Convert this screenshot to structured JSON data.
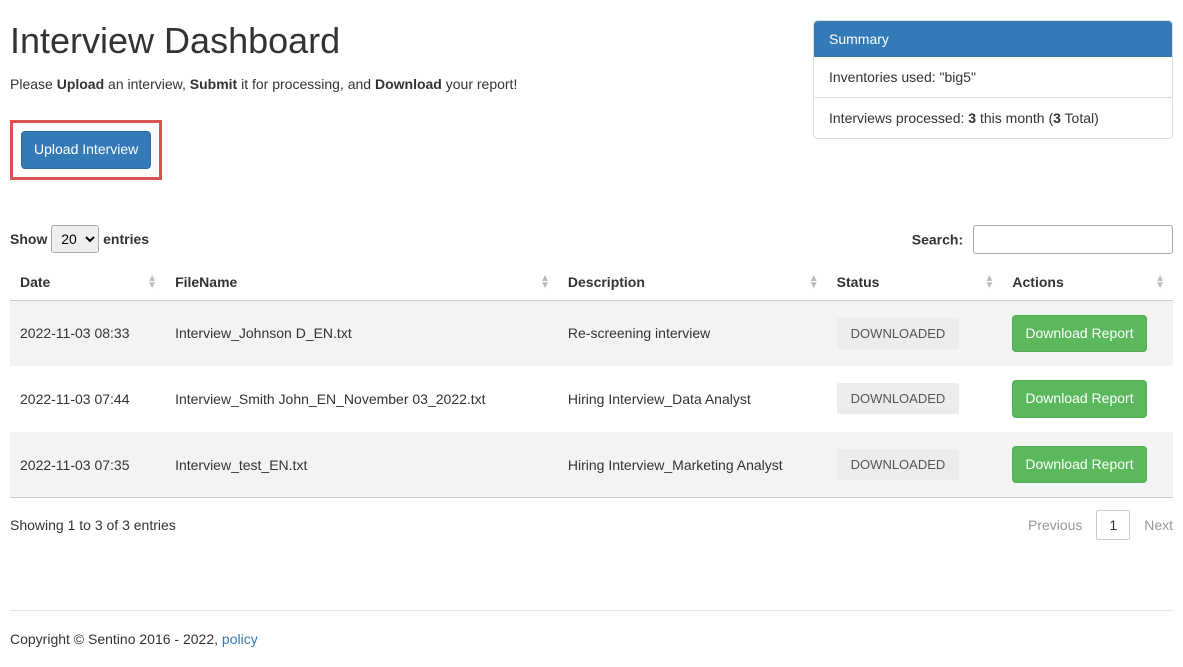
{
  "header": {
    "title": "Interview Dashboard",
    "intro_pre": "Please ",
    "intro_b1": "Upload",
    "intro_mid1": " an interview, ",
    "intro_b2": "Submit",
    "intro_mid2": " it for processing, and ",
    "intro_b3": "Download",
    "intro_post": " your report!",
    "upload_btn": "Upload Interview"
  },
  "summary": {
    "heading": "Summary",
    "line1": "Inventories used: \"big5\"",
    "line2_pre": "Interviews processed: ",
    "line2_this_month": "3",
    "line2_mid": " this month (",
    "line2_total": "3",
    "line2_post": " Total)"
  },
  "table": {
    "length_pre": "Show",
    "length_post": "entries",
    "length_value": "20",
    "search_label": "Search:",
    "columns": {
      "date": "Date",
      "filename": "FileName",
      "description": "Description",
      "status": "Status",
      "actions": "Actions"
    },
    "rows": [
      {
        "date": "2022-11-03 08:33",
        "file": "Interview_Johnson D_EN.txt",
        "desc": "Re-screening interview",
        "status": "DOWNLOADED",
        "action": "Download Report"
      },
      {
        "date": "2022-11-03 07:44",
        "file": "Interview_Smith John_EN_November 03_2022.txt",
        "desc": "Hiring Interview_Data Analyst",
        "status": "DOWNLOADED",
        "action": "Download Report"
      },
      {
        "date": "2022-11-03 07:35",
        "file": "Interview_test_EN.txt",
        "desc": "Hiring Interview_Marketing Analyst",
        "status": "DOWNLOADED",
        "action": "Download Report"
      }
    ],
    "info": "Showing 1 to 3 of 3 entries",
    "prev": "Previous",
    "page": "1",
    "next": "Next"
  },
  "footer": {
    "copyright": "Copyright © Sentino 2016 - 2022, ",
    "policy": "policy"
  }
}
